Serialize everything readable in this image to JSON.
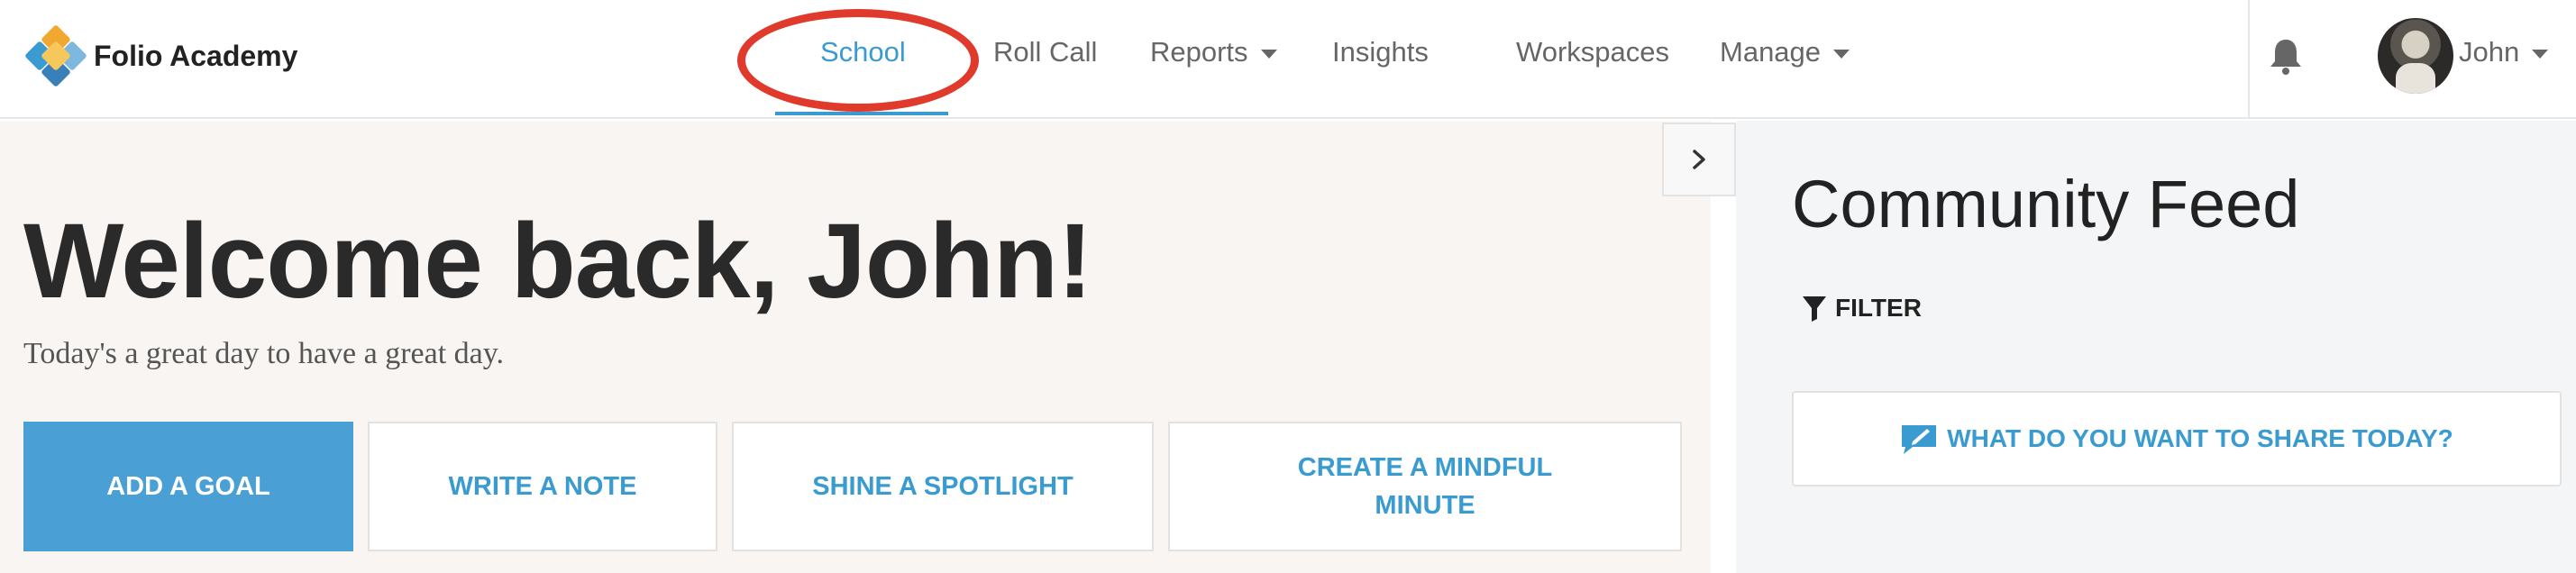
{
  "brand": {
    "name": "Folio Academy"
  },
  "nav": {
    "items": [
      {
        "label": "School",
        "active": true
      },
      {
        "label": "Roll Call"
      },
      {
        "label": "Reports",
        "dropdown": true
      },
      {
        "label": "Insights"
      },
      {
        "label": "Workspaces"
      },
      {
        "label": "Manage",
        "dropdown": true
      }
    ]
  },
  "user": {
    "name": "John",
    "icon": "bell-icon"
  },
  "main": {
    "welcome": "Welcome back, John!",
    "tagline": "Today's a great day to have a great day.",
    "actions": [
      {
        "label": "ADD A GOAL"
      },
      {
        "label": "WRITE A NOTE"
      },
      {
        "label": "SHINE A SPOTLIGHT"
      },
      {
        "label": "CREATE A MINDFUL MINUTE"
      }
    ]
  },
  "feed": {
    "title": "Community Feed",
    "filter_label": "FILTER",
    "share_prompt": "WHAT DO YOU WANT TO SHARE TODAY?"
  },
  "colors": {
    "accent": "#3a9bd1",
    "primary_button": "#4aa0d5",
    "highlight": "#e03a2c"
  }
}
